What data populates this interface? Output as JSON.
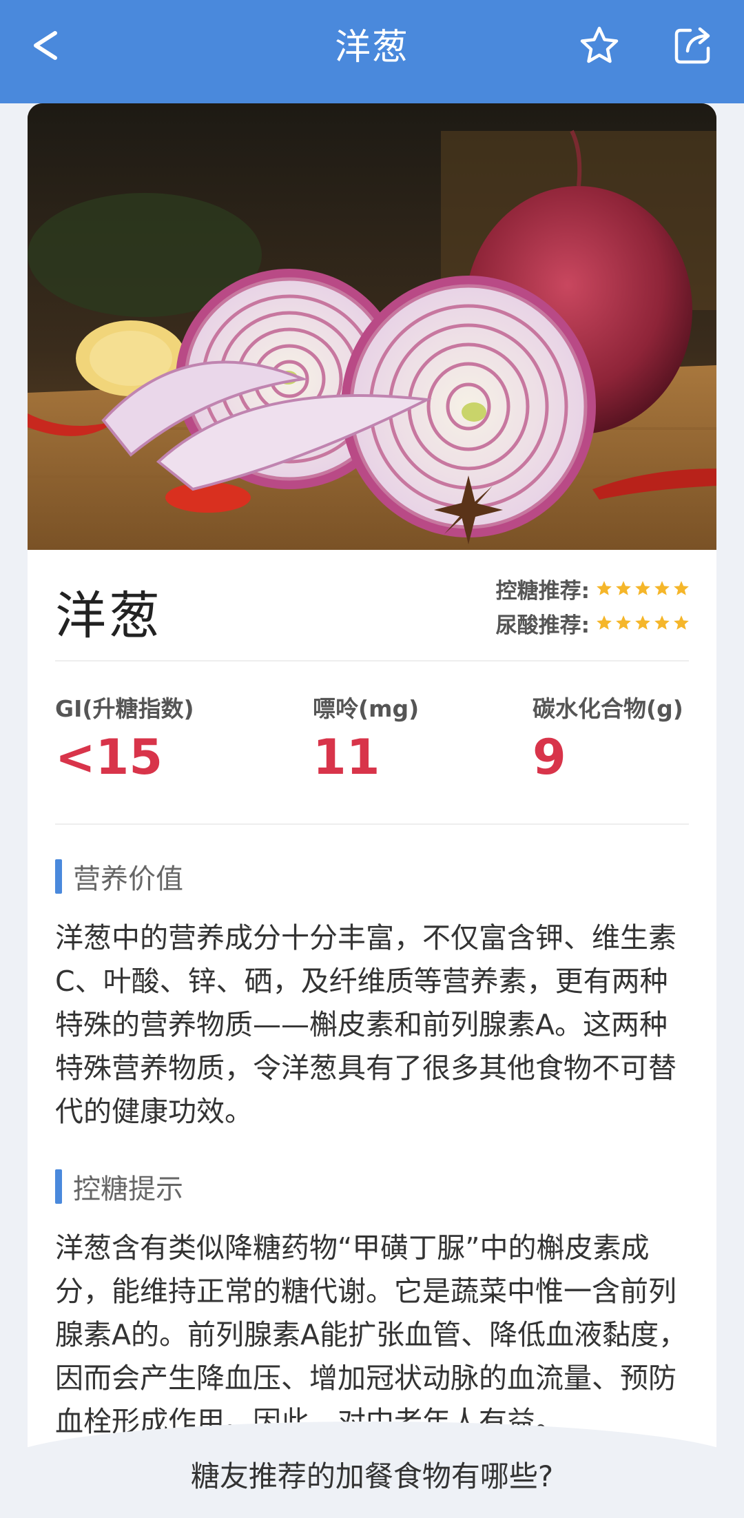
{
  "header": {
    "title": "洋葱",
    "back_icon": "chevron-left-icon",
    "favorite_icon": "star-outline-icon",
    "share_icon": "share-icon",
    "background_color": "#4a89dc"
  },
  "food": {
    "name": "洋葱",
    "ratings": [
      {
        "label": "控糖推荐:",
        "stars": 5
      },
      {
        "label": "尿酸推荐:",
        "stars": 5
      }
    ],
    "star_color": "#f5b62a"
  },
  "metrics": [
    {
      "label": "GI(升糖指数)",
      "value": "<15"
    },
    {
      "label": "嘌呤(mg)",
      "value": "11"
    },
    {
      "label": "碳水化合物(g)",
      "value": "9"
    }
  ],
  "metric_value_color": "#d8344a",
  "sections": [
    {
      "title": "营养价值",
      "text": "洋葱中的营养成分十分丰富，不仅富含钾、维生素C、叶酸、锌、硒，及纤维质等营养素，更有两种特殊的营养物质——槲皮素和前列腺素A。这两种特殊营养物质，令洋葱具有了很多其他食物不可替代的健康功效。"
    },
    {
      "title": "控糖提示",
      "text": "洋葱含有类似降糖药物“甲磺丁脲”中的槲皮素成分，能维持正常的糖代谢。它是蔬菜中惟一含前列腺素A的。前列腺素A能扩张血管、降低血液黏度，因而会产生降血压、增加冠状动脉的血流量、预防血栓形成作用。因此，对中老年人有益。"
    }
  ],
  "bottom_bar": {
    "text": "糖友推荐的加餐食物有哪些?"
  }
}
